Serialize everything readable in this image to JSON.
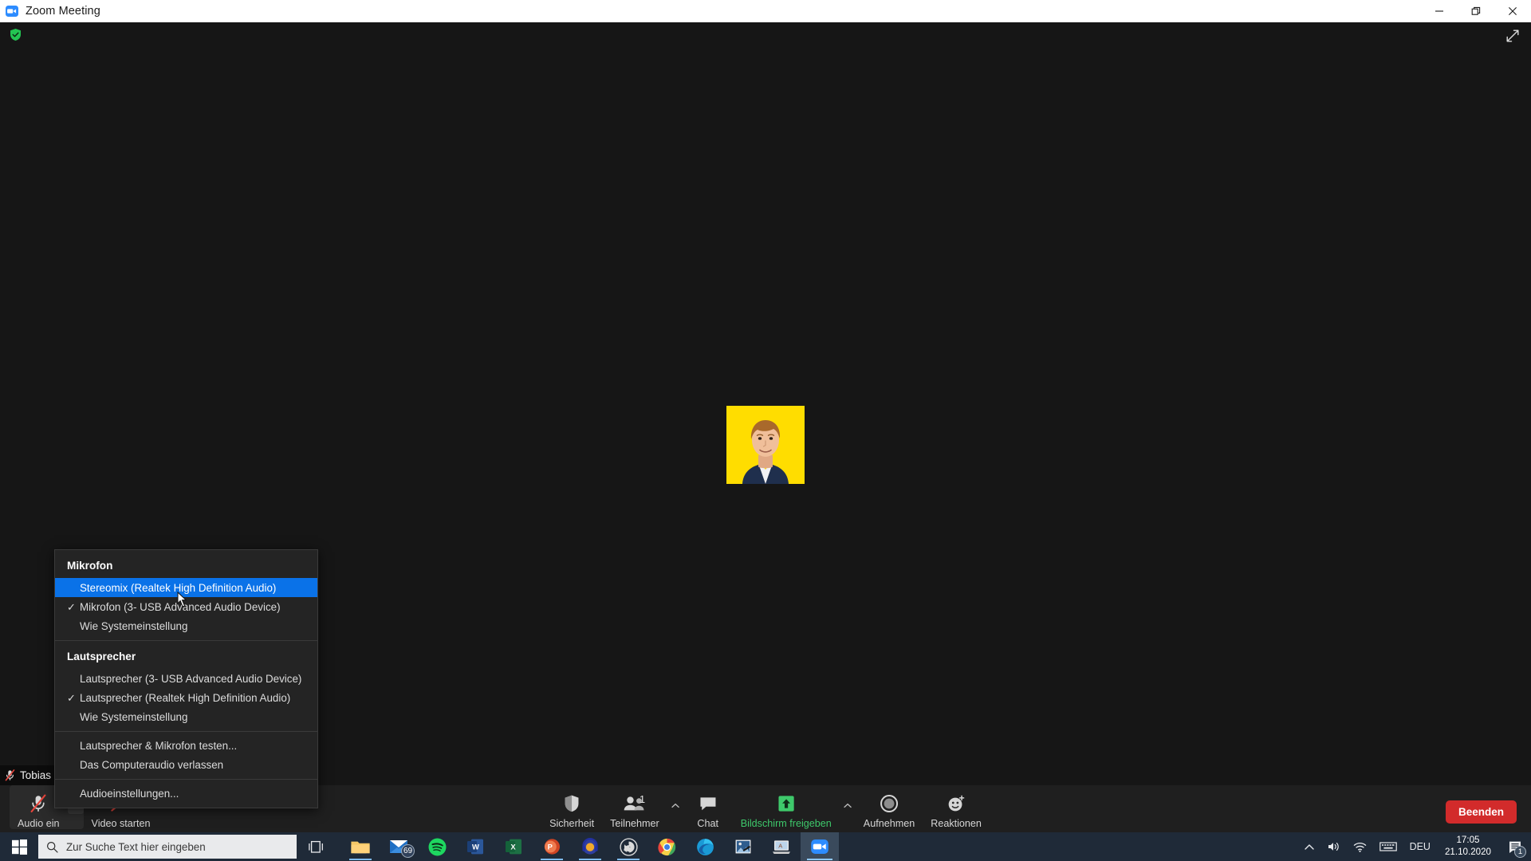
{
  "window": {
    "title": "Zoom Meeting",
    "app_icon": "zoom-camera-icon",
    "minimize_label": "Minimieren",
    "restore_label": "Wiederherstellen",
    "close_label": "Schließen"
  },
  "stage": {
    "encryption_icon": "green-shield-check-icon",
    "fullscreen_icon": "expand-diagonal-icon",
    "participant": {
      "name": "Tobias B",
      "mic_status_icon": "microphone-muted-icon",
      "avatar_bg": "#ffdd00"
    }
  },
  "audio_menu": {
    "microphone_header": "Mikrofon",
    "microphone_items": [
      {
        "label": "Stereomix (Realtek High Definition Audio)",
        "checked": false,
        "highlighted": true
      },
      {
        "label": "Mikrofon (3- USB Advanced Audio Device)",
        "checked": true,
        "highlighted": false
      },
      {
        "label": "Wie Systemeinstellung",
        "checked": false,
        "highlighted": false
      }
    ],
    "speaker_header": "Lautsprecher",
    "speaker_items": [
      {
        "label": "Lautsprecher (3- USB Advanced Audio Device)",
        "checked": false,
        "highlighted": false
      },
      {
        "label": "Lautsprecher (Realtek High Definition Audio)",
        "checked": true,
        "highlighted": false
      },
      {
        "label": "Wie Systemeinstellung",
        "checked": false,
        "highlighted": false
      }
    ],
    "actions": [
      {
        "label": "Lautsprecher & Mikrofon testen..."
      },
      {
        "label": "Das Computeraudio verlassen"
      }
    ],
    "settings": [
      {
        "label": "Audioeinstellungen..."
      }
    ],
    "checkmark_glyph": "✓",
    "highlight_color": "#0a72e8"
  },
  "toolbar": {
    "audio": {
      "label": "Audio ein",
      "icon": "microphone-muted-icon",
      "caret": "chevron-up-icon"
    },
    "video": {
      "label": "Video starten",
      "icon": "camera-muted-icon",
      "caret": "chevron-up-icon"
    },
    "items": [
      {
        "label": "Sicherheit",
        "icon": "shield-icon",
        "caret": false,
        "count": "",
        "green": false
      },
      {
        "label": "Teilnehmer",
        "icon": "participants-icon",
        "caret": true,
        "count": "1",
        "green": false
      },
      {
        "label": "Chat",
        "icon": "chat-bubble-icon",
        "caret": false,
        "count": "",
        "green": false
      },
      {
        "label": "Bildschirm freigeben",
        "icon": "share-screen-icon",
        "caret": true,
        "count": "",
        "green": true
      },
      {
        "label": "Aufnehmen",
        "icon": "record-circle-icon",
        "caret": false,
        "count": "",
        "green": false
      },
      {
        "label": "Reaktionen",
        "icon": "reactions-smiley-icon",
        "caret": false,
        "count": "",
        "green": false
      }
    ],
    "end_button": {
      "label": "Beenden",
      "color": "#d22b2b"
    },
    "share_accent": "#3ec96b"
  },
  "taskbar": {
    "start_icon": "windows-start-icon",
    "search": {
      "placeholder": "Zur Suche Text hier eingeben",
      "icon": "search-icon"
    },
    "taskview_icon": "task-view-icon",
    "apps": [
      {
        "name": "file-explorer",
        "badge": "",
        "state": "open"
      },
      {
        "name": "mail",
        "badge": "69",
        "state": "idle"
      },
      {
        "name": "spotify",
        "badge": "",
        "state": "idle"
      },
      {
        "name": "word",
        "badge": "",
        "state": "idle"
      },
      {
        "name": "excel",
        "badge": "",
        "state": "idle"
      },
      {
        "name": "powerpoint",
        "badge": "",
        "state": "open"
      },
      {
        "name": "audio-headphones",
        "badge": "",
        "state": "open"
      },
      {
        "name": "obs-studio",
        "badge": "",
        "state": "open"
      },
      {
        "name": "chrome",
        "badge": "",
        "state": "idle"
      },
      {
        "name": "edge",
        "badge": "",
        "state": "idle"
      },
      {
        "name": "photo-editor",
        "badge": "",
        "state": "idle"
      },
      {
        "name": "remote-desktop",
        "badge": "",
        "state": "idle"
      },
      {
        "name": "zoom",
        "badge": "",
        "state": "active"
      }
    ],
    "tray": {
      "overflow_icon": "chevron-up-icon",
      "volume_icon": "speaker-icon",
      "network_icon": "wifi-icon",
      "keyboard_icon": "keyboard-icon",
      "language": "DEU",
      "time": "17:05",
      "date": "21.10.2020",
      "notification_icon": "action-center-icon",
      "notification_count": "1"
    }
  }
}
